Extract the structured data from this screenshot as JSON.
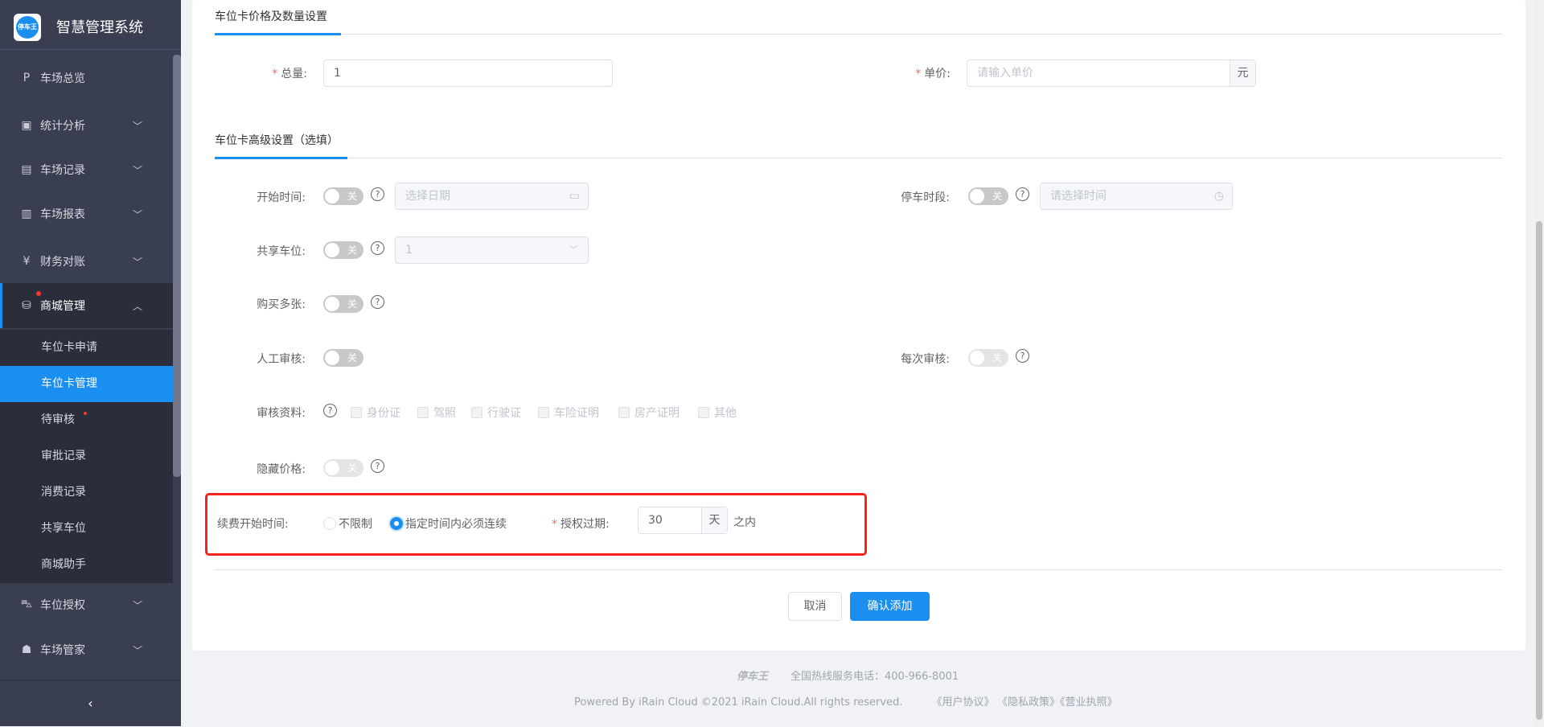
{
  "app": {
    "title": "智慧管理系统",
    "logo_text": "停车王"
  },
  "sidebar": {
    "items": [
      {
        "label": "车场总览",
        "icon": "parking-icon"
      },
      {
        "label": "统计分析",
        "icon": "monitor-chart-icon"
      },
      {
        "label": "车场记录",
        "icon": "document-icon"
      },
      {
        "label": "车场报表",
        "icon": "report-icon"
      },
      {
        "label": "财务对账",
        "icon": "yuan-icon"
      },
      {
        "label": "商城管理",
        "icon": "shop-icon"
      },
      {
        "label": "车位授权",
        "icon": "car-icon"
      },
      {
        "label": "车场管家",
        "icon": "user-icon"
      }
    ],
    "sub_items": [
      "车位卡申请",
      "车位卡管理",
      "待审核",
      "审批记录",
      "消费记录",
      "共享车位",
      "商城助手"
    ],
    "collapse": "‹"
  },
  "sections": {
    "price": "车位卡价格及数量设置",
    "advanced": "车位卡高级设置（选填）"
  },
  "form": {
    "total_label": "总量:",
    "total_value": "1",
    "price_label": "单价:",
    "price_placeholder": "请输入单价",
    "price_unit": "元",
    "start_time_label": "开始时间:",
    "start_time_placeholder": "选择日期",
    "parking_period_label": "停车时段:",
    "parking_period_placeholder": "请选择时间",
    "share_label": "共享车位:",
    "share_value": "1",
    "multi_label": "购买多张:",
    "manual_review_label": "人工审核:",
    "each_review_label": "每次审核:",
    "docs_label": "审核资料:",
    "docs": [
      "身份证",
      "驾照",
      "行驶证",
      "车险证明",
      "房产证明",
      "其他"
    ],
    "hide_price_label": "隐藏价格:",
    "toggle_off": "关",
    "help": "?",
    "renew_label": "续费开始时间:",
    "renew_options": [
      "不限制",
      "指定时间内必须连续"
    ],
    "expire_label": "授权过期:",
    "expire_value": "30",
    "expire_unit": "天",
    "expire_suffix": "之内",
    "required_mark": "*"
  },
  "buttons": {
    "cancel": "取消",
    "confirm": "确认添加"
  },
  "footer": {
    "brand": "停车王",
    "hotline": "全国热线服务电话：400-966-8001",
    "copyright": "Powered By iRain Cloud ©2021 iRain Cloud.All rights reserved.",
    "links": [
      "《用户协议》",
      "《隐私政策》",
      "《营业执照》"
    ]
  },
  "colors": {
    "accent": "#1b8ff0",
    "sidebar": "#393f50",
    "highlight": "#f5231d"
  }
}
